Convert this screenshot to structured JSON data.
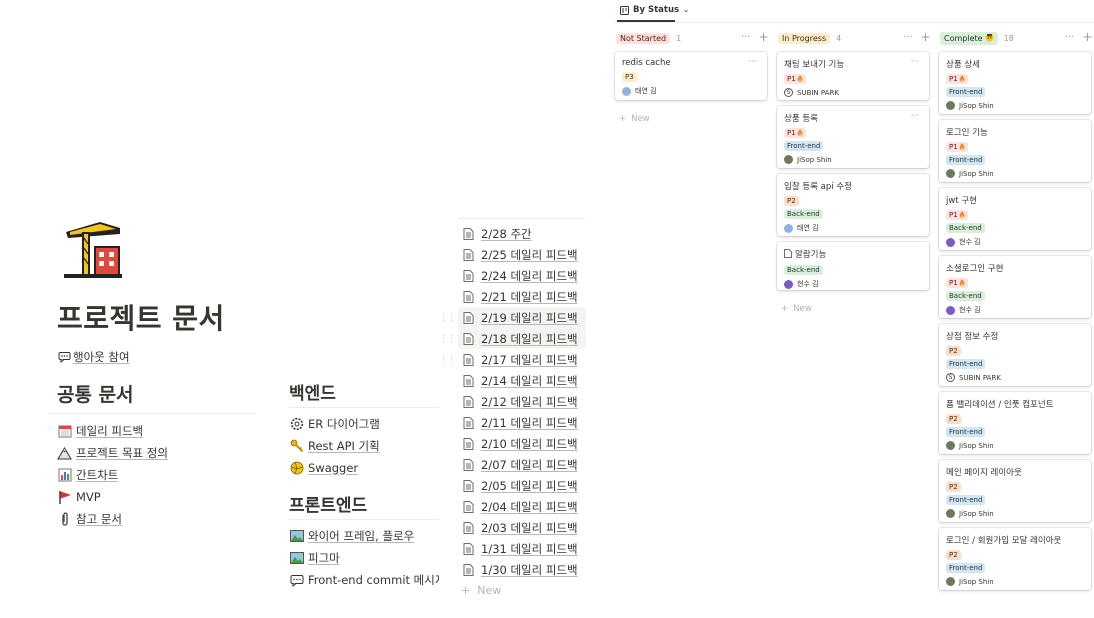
{
  "page": {
    "title": "프로젝트 문서",
    "huddle_link": "행아웃 참여",
    "common_heading": "공통 문서",
    "common_links": [
      {
        "label": "데일리 피드백",
        "icon": "calendar-icon"
      },
      {
        "label": "프로젝트 목표 정의",
        "icon": "mountain-icon"
      },
      {
        "label": "간트차트",
        "icon": "bar-chart-icon"
      },
      {
        "label": "MVP",
        "icon": "red-flag-icon"
      },
      {
        "label": "참고 문서",
        "icon": "paperclip-icon"
      }
    ],
    "backend_heading": "백엔드",
    "backend_links": [
      {
        "label": "ER 다이어그램",
        "icon": "gear-icon"
      },
      {
        "label": "Rest API 기획",
        "icon": "key-icon"
      },
      {
        "label": "Swagger",
        "icon": "ball-icon"
      }
    ],
    "frontend_heading": "프론트엔드",
    "frontend_links": [
      {
        "label": "와이어 프레임, 플로우",
        "icon": "picture-icon"
      },
      {
        "label": "피그마",
        "icon": "picture-icon"
      },
      {
        "label": "Front-end commit 메시지 규칙",
        "icon": "speech-bubble-icon"
      }
    ]
  },
  "feedback_list": {
    "items": [
      "2/28 주간",
      "2/25 데일리 피드백",
      "2/24 데일리 피드백",
      "2/21 데일리 피드백",
      "2/19 데일리 피드백",
      "2/18 데일리 피드백",
      "2/17 데일리 피드백",
      "2/14 데일리 피드백",
      "2/12 데일리 피드백",
      "2/11 데일리 피드백",
      "2/10 데일리 피드백",
      "2/07 데일리 피드백",
      "2/05 데일리 피드백",
      "2/04 데일리 피드백",
      "2/03 데일리 피드백",
      "1/31 데일리 피드백",
      "1/30 데일리 피드백"
    ],
    "new_label": "New"
  },
  "board": {
    "view_label": "By Status",
    "new_label": "New",
    "columns": [
      {
        "status": "Not Started",
        "count": "1",
        "color": "#ffe2dd",
        "text_color": "#5d1715"
      },
      {
        "status": "In Progress",
        "count": "4",
        "color": "#fdecc8",
        "text_color": "#402c1b"
      },
      {
        "status": "Complete",
        "count": "18",
        "color": "#dbeddb",
        "text_color": "#1c3829"
      }
    ],
    "cards": {
      "not_started": [
        {
          "title": "redis cache",
          "priority": "P3",
          "person": "태연 김"
        }
      ],
      "in_progress": [
        {
          "title": "채팅 보내기 기능",
          "priority": "P1",
          "person": "SUBIN PARK"
        },
        {
          "title": "상품 등록",
          "priority": "P1",
          "area": "Front-end",
          "person": "JiSop Shin"
        },
        {
          "title": "입찰 등록 api 수정",
          "priority": "P2",
          "area": "Back-end",
          "person": "태연 김"
        },
        {
          "title": "알람기능",
          "area": "Back-end",
          "person": "현수 김"
        }
      ],
      "complete": [
        {
          "title": "상품 상세",
          "priority": "P1",
          "area": "Front-end",
          "person": "JiSop Shin"
        },
        {
          "title": "로그인 기능",
          "priority": "P1",
          "area": "Front-end",
          "person": "JiSop Shin"
        },
        {
          "title": "jwt 구현",
          "priority": "P1",
          "area": "Back-end",
          "person": "현수 김"
        },
        {
          "title": "소셜로그인 구현",
          "priority": "P1",
          "area": "Back-end",
          "person": "현수 김"
        },
        {
          "title": "상점 정보 수정",
          "priority": "P2",
          "area": "Front-end",
          "person": "SUBIN PARK"
        },
        {
          "title": "폼 밸리데이션 / 인풋 컴포넌트",
          "priority": "P2",
          "area": "Front-end",
          "person": "JiSop Shin"
        },
        {
          "title": "메인 페이지 레이아웃",
          "priority": "P2",
          "area": "Front-end",
          "person": "JiSop Shin"
        },
        {
          "title": "로그인 / 회원가입 모달 레이아웃",
          "priority": "P2",
          "area": "Front-end",
          "person": "JiSop Shin"
        }
      ]
    },
    "colors": {
      "p1": "#ffe2dd",
      "p2": "#fadec9",
      "p3": "#fdecc8",
      "front_end": "#d3e5ef",
      "back_end": "#dbeddb",
      "avatar_taeyeon": "#8fb3e0",
      "avatar_hyunsoo": "#7c5cc4",
      "avatar_jisop": "#6a7a5a"
    }
  }
}
